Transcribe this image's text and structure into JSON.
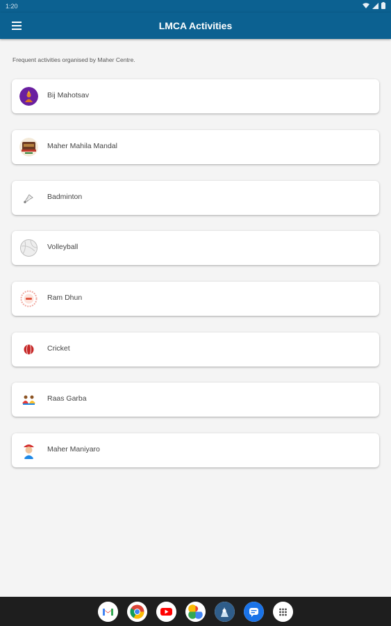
{
  "status": {
    "time": "1:20",
    "icons": [
      "wifi-icon",
      "signal-icon",
      "battery-icon"
    ]
  },
  "appbar": {
    "title": "LMCA Activities",
    "menu_icon": "menu-icon",
    "color": "#0c6191"
  },
  "intro": "Frequent activities organised by Maher Centre.",
  "activities": [
    {
      "label": "Bij Mahotsav",
      "icon": "deity-icon"
    },
    {
      "label": "Maher Mahila Mandal",
      "icon": "mandal-logo-icon"
    },
    {
      "label": "Badminton",
      "icon": "shuttlecock-icon"
    },
    {
      "label": "Volleyball",
      "icon": "volleyball-icon"
    },
    {
      "label": "Ram Dhun",
      "icon": "ram-dhun-icon"
    },
    {
      "label": "Cricket",
      "icon": "cricket-ball-icon"
    },
    {
      "label": "Raas Garba",
      "icon": "raas-garba-icon"
    },
    {
      "label": "Maher Maniyaro",
      "icon": "maniyaro-icon"
    }
  ],
  "dock": [
    "gmail-icon",
    "chrome-icon",
    "youtube-icon",
    "photos-icon",
    "custom-app-icon",
    "messages-icon",
    "app-drawer-icon"
  ]
}
